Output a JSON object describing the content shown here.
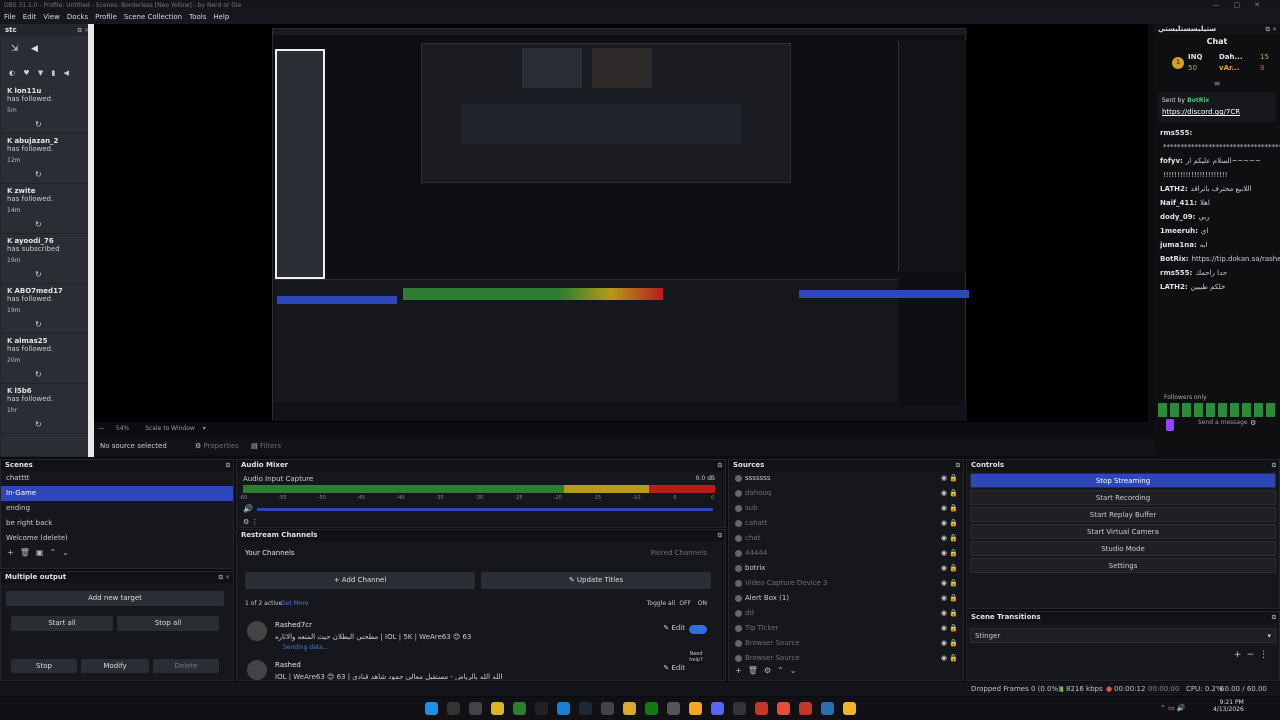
{
  "window": {
    "title": "OBS 31.1.0 - Profile: Untitled - Scenes: Borderless [Neo Yellow] - by Nerd or Die"
  },
  "menu": [
    "File",
    "Edit",
    "View",
    "Docks",
    "Profile",
    "Scene Collection",
    "Tools",
    "Help"
  ],
  "left_dock": {
    "title": "stc",
    "events": [
      {
        "user": "lon11u",
        "text": "has followed.",
        "time": "5m"
      },
      {
        "user": "abujazan_2",
        "text": "has followed.",
        "time": "12m"
      },
      {
        "user": "zwite",
        "text": "has followed.",
        "time": "14m"
      },
      {
        "user": "ayoodi_76",
        "text": "has subscribed",
        "time": "19m"
      },
      {
        "user": "ABO7med17",
        "text": "has followed.",
        "time": "19m"
      },
      {
        "user": "almas25",
        "text": "has followed.",
        "time": "20m"
      },
      {
        "user": "l5b6",
        "text": "has followed.",
        "time": "1hr"
      }
    ]
  },
  "preview_bar": {
    "zoom": "54%",
    "scale": "Scale to Window"
  },
  "source_toolbar": {
    "no_source": "No source selected",
    "properties": "Properties",
    "filters": "Filters"
  },
  "scenes": {
    "title": "Scenes",
    "items": [
      "chatttt",
      "In-Game",
      "ending",
      "be right back",
      "Welcome (delete)"
    ],
    "selected": 1
  },
  "audio_mixer": {
    "title": "Audio Mixer",
    "track": "Audio Input Capture",
    "level": "0.0 dB",
    "ticks": [
      "-60",
      "-55",
      "-50",
      "-45",
      "-40",
      "-35",
      "-30",
      "-25",
      "-20",
      "-15",
      "-10",
      "-5",
      "0"
    ]
  },
  "sources": {
    "title": "Sources",
    "items": [
      {
        "name": "sssssss",
        "dim": false
      },
      {
        "name": "dahooq",
        "dim": true
      },
      {
        "name": "sub",
        "dim": true
      },
      {
        "name": "cahatt",
        "dim": true
      },
      {
        "name": "chat",
        "dim": true
      },
      {
        "name": "44444",
        "dim": true
      },
      {
        "name": "botrix",
        "dim": false
      },
      {
        "name": "Video Capture Device 3",
        "dim": true
      },
      {
        "name": "Alert Box (1)",
        "dim": false
      },
      {
        "name": "dd",
        "dim": true
      },
      {
        "name": "Tip Ticker",
        "dim": true
      },
      {
        "name": "Browser Source",
        "dim": true
      },
      {
        "name": "Browser Source",
        "dim": true
      }
    ]
  },
  "controls": {
    "title": "Controls",
    "buttons": [
      "Stop Streaming",
      "Start Recording",
      "Start Replay Buffer",
      "Start Virtual Camera",
      "Studio Mode",
      "Settings"
    ]
  },
  "scene_transitions": {
    "title": "Scene Transitions",
    "value": "Stinger"
  },
  "restream": {
    "title": "Restream Channels",
    "your_channels": "Your Channels",
    "paired": "Paired Channels",
    "add": "Add Channel",
    "update": "Update Titles",
    "active": "1 of 2 active",
    "get_more": "Get More",
    "toggle_all": "Toggle all",
    "off": "OFF",
    "on": "ON",
    "channels": [
      {
        "name": "Rashed7cr",
        "title": "مطحني البطلان حيث المتعه والاثاره | IOL | 5K | WeAre63 😊 63",
        "status": "Sending data...",
        "edit": "Edit"
      },
      {
        "name": "Rashed",
        "title": "IOL | WeAre63 😊 63 | الله الله بالرياض - مستقبل معالي حمود شاهد قنادي",
        "status": "",
        "edit": "Edit"
      }
    ],
    "help": "Need help?"
  },
  "multiple_output": {
    "title": "Multiple output",
    "add": "Add new target",
    "start_all": "Start all",
    "stop_all": "Stop all",
    "stop": "Stop",
    "modify": "Modify",
    "delete": "Delete"
  },
  "chat": {
    "header": "ستيلبسستلبستي",
    "title": "Chat",
    "leaders": [
      {
        "name": "INQ",
        "score": "15"
      },
      {
        "name": "Dah...",
        "score": "50"
      },
      {
        "name": "vAr...",
        "score": "8"
      }
    ],
    "pinned": {
      "label": "Sent by",
      "user": "BotRix",
      "link": "https://discord.gg/7CR"
    },
    "messages": [
      {
        "user": "rms555:",
        "text": ""
      },
      {
        "user": "",
        "text": "*****************************************"
      },
      {
        "user": "fofyv:",
        "text": "السلام عليكم ار~~~~~"
      },
      {
        "user": "",
        "text": "!!!!!!!!!!!!!!!!!!!!!!!"
      },
      {
        "user": "LATH2:",
        "text": "اللابيع محترف باتراقد"
      },
      {
        "user": "Naif_411:",
        "text": "اهلا"
      },
      {
        "user": "dody_09:",
        "text": "ربي"
      },
      {
        "user": "1meeruh:",
        "text": "اي"
      },
      {
        "user": "juma1na:",
        "text": "ابه"
      },
      {
        "user": "BotRix:",
        "text": "https://tip.dokan.sa/rashed7cr"
      },
      {
        "user": "rms555:",
        "text": "حدا راحمك"
      },
      {
        "user": "LATH2:",
        "text": "خلكم طيبين"
      }
    ],
    "followers_only": "Followers only",
    "send": "Send a message"
  },
  "status": {
    "dropped": "Dropped Frames 0 (0.0%)",
    "kbps": "8216 kbps",
    "stream_time": "00:00:12",
    "rec_time": "00:00:00",
    "cpu": "CPU: 0.2%",
    "fps": "60.00 / 60.00 FPS"
  },
  "clock": {
    "time": "9:21 PM",
    "date": "4/13/2026"
  }
}
